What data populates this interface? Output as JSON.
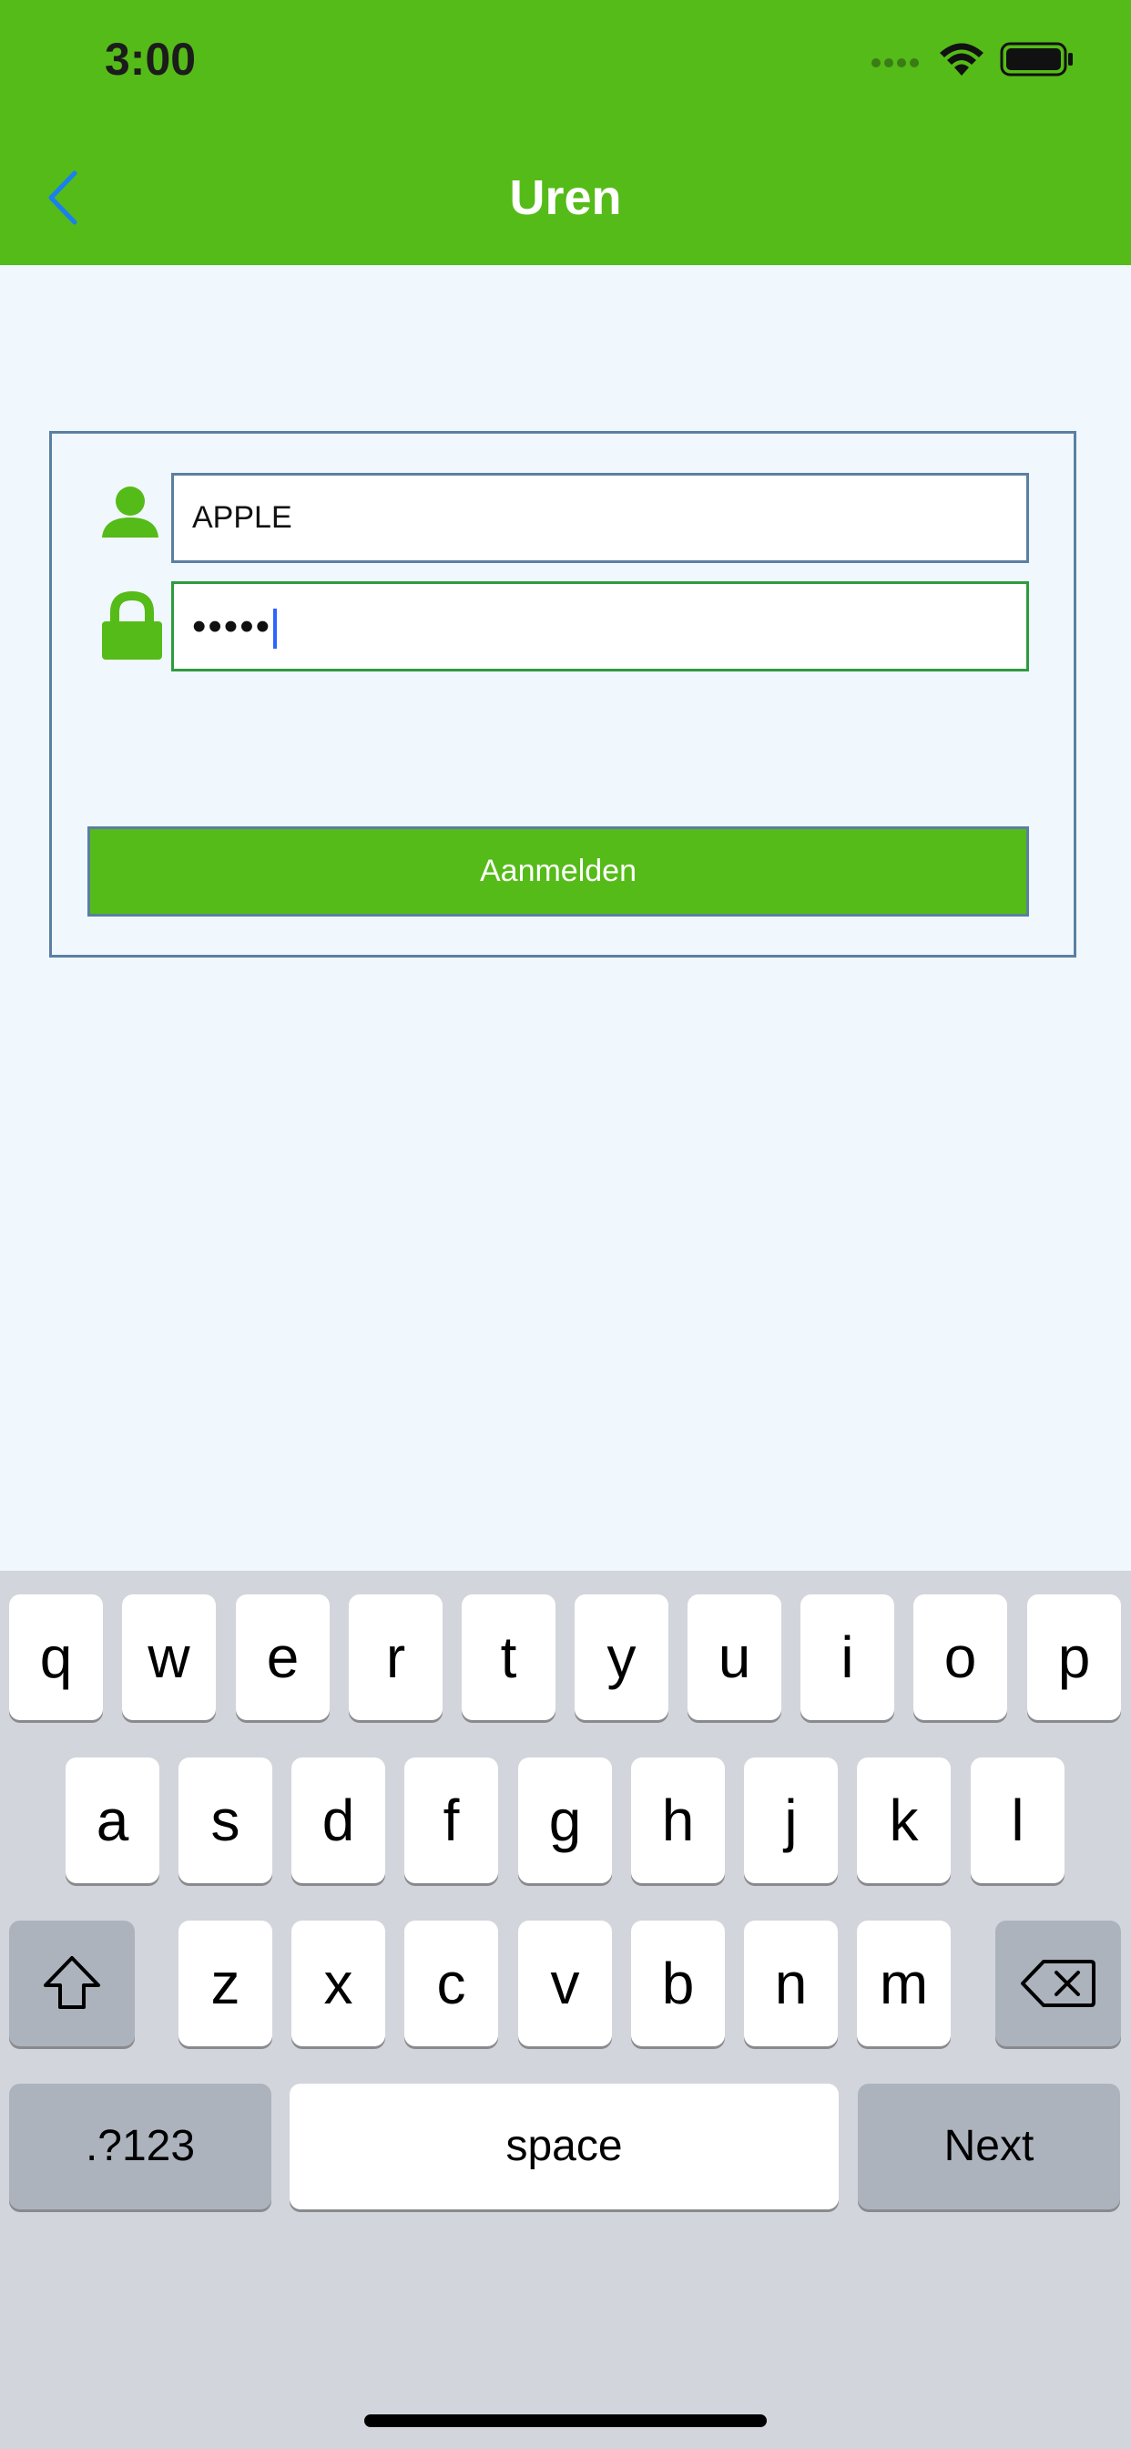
{
  "status_bar": {
    "time": "3:00"
  },
  "nav": {
    "title": "Uren",
    "back_icon": "chevron-left-icon"
  },
  "login": {
    "username_value": "APPLE",
    "password_value": "•••••",
    "button_label": "Aanmelden",
    "user_icon": "user-icon",
    "lock_icon": "lock-icon"
  },
  "keyboard": {
    "row1": [
      "q",
      "w",
      "e",
      "r",
      "t",
      "y",
      "u",
      "i",
      "o",
      "p"
    ],
    "row2": [
      "a",
      "s",
      "d",
      "f",
      "g",
      "h",
      "j",
      "k",
      "l"
    ],
    "row3": [
      "z",
      "x",
      "c",
      "v",
      "b",
      "n",
      "m"
    ],
    "numbers_label": ".?123",
    "space_label": "space",
    "next_label": "Next"
  },
  "colors": {
    "accent_green": "#55bb18",
    "background": "#f0f8fe",
    "border_blue": "#5b7fa2",
    "back_arrow_blue": "#1a7ff0"
  }
}
